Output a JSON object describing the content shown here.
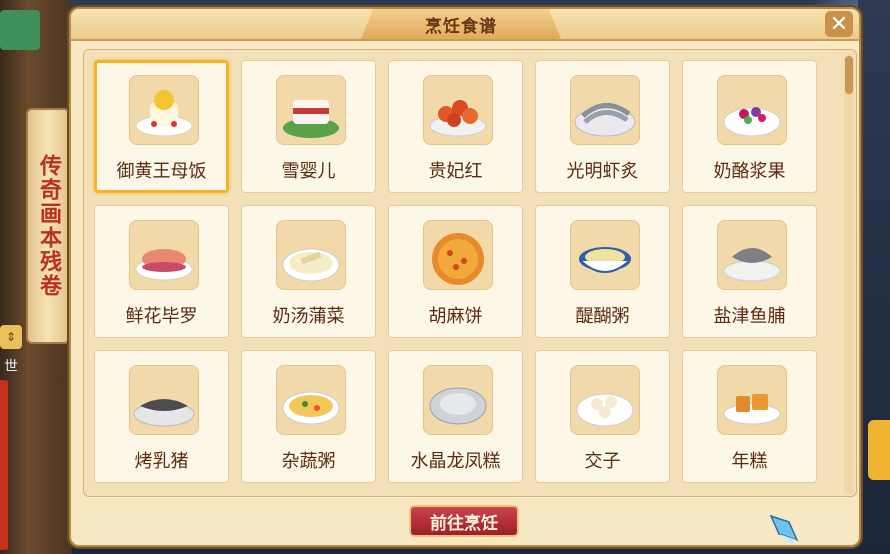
{
  "window": {
    "title": "烹饪食谱",
    "go_button": "前往烹饪"
  },
  "side_scroll": {
    "text": "传奇画本残卷"
  },
  "side_hud": {
    "world_label": "世"
  },
  "recipes": [
    {
      "name": "御黄王母饭",
      "icon": "rice-cake-dish",
      "selected": true
    },
    {
      "name": "雪婴儿",
      "icon": "white-cake-dish",
      "selected": false
    },
    {
      "name": "贵妃红",
      "icon": "red-pastry-dish",
      "selected": false
    },
    {
      "name": "光明虾炙",
      "icon": "grilled-shrimp-dish",
      "selected": false
    },
    {
      "name": "奶酪浆果",
      "icon": "berry-bowl-dish",
      "selected": false
    },
    {
      "name": "鲜花毕罗",
      "icon": "flower-pastry-dish",
      "selected": false
    },
    {
      "name": "奶汤蒲菜",
      "icon": "milk-soup-dish",
      "selected": false
    },
    {
      "name": "胡麻饼",
      "icon": "sesame-pancake-dish",
      "selected": false
    },
    {
      "name": "醍醐粥",
      "icon": "porridge-bowl-dish",
      "selected": false
    },
    {
      "name": "盐津鱼脯",
      "icon": "dried-fish-dish",
      "selected": false
    },
    {
      "name": "烤乳猪",
      "icon": "roast-pig-dish",
      "selected": false
    },
    {
      "name": "杂蔬粥",
      "icon": "vegetable-porridge-dish",
      "selected": false
    },
    {
      "name": "水晶龙凤糕",
      "icon": "crystal-cake-dish",
      "selected": false
    },
    {
      "name": "交子",
      "icon": "dumpling-dish",
      "selected": false
    },
    {
      "name": "年糕",
      "icon": "rice-cake-slices-dish",
      "selected": false
    }
  ],
  "colors": {
    "panel": "#f7e8c4",
    "selected_border": "#f3b428",
    "label_text": "#5b2b12",
    "button": "#9c1f2a"
  }
}
